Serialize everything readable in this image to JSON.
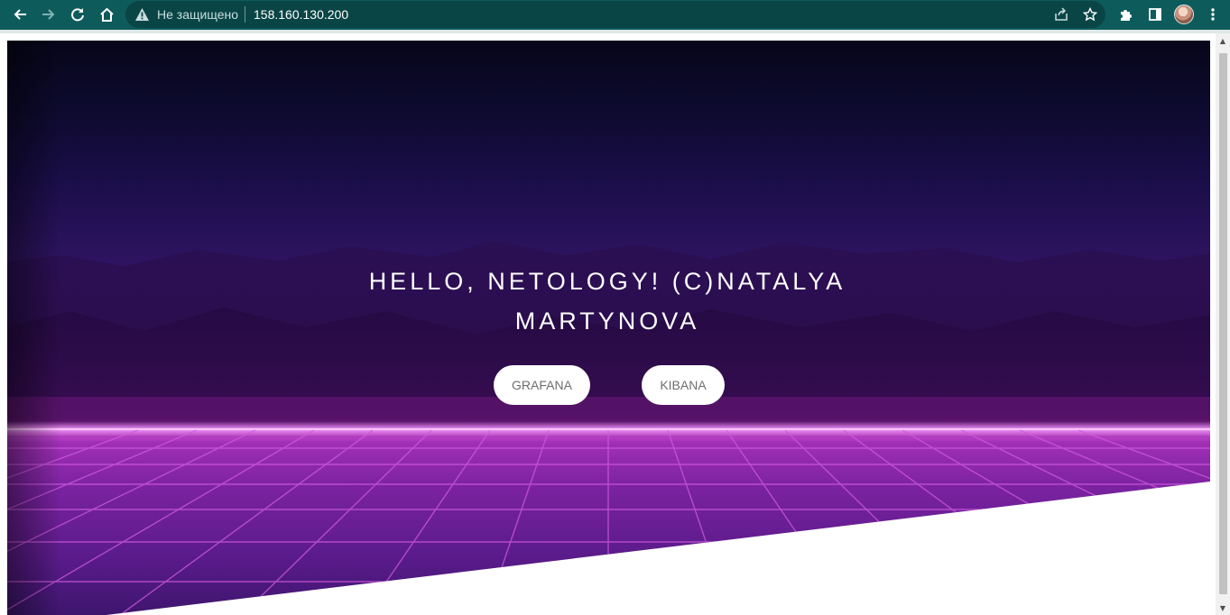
{
  "browser": {
    "insecure_label": "Не защищено",
    "url": "158.160.130.200"
  },
  "hero": {
    "title": "HELLO, NETOLOGY! (C)NATALYA MARTYNOVA",
    "buttons": [
      {
        "label": "GRAFANA"
      },
      {
        "label": "KIBANA"
      }
    ]
  },
  "colors": {
    "chrome_bg": "#0e5b5c",
    "accent_grid": "#d05ae0",
    "horizon": "#e27af0"
  },
  "icons": [
    "back-icon",
    "forward-icon",
    "reload-icon",
    "home-icon",
    "warning-icon",
    "share-icon",
    "star-icon",
    "extensions-icon",
    "side-panel-icon",
    "menu-icon"
  ]
}
